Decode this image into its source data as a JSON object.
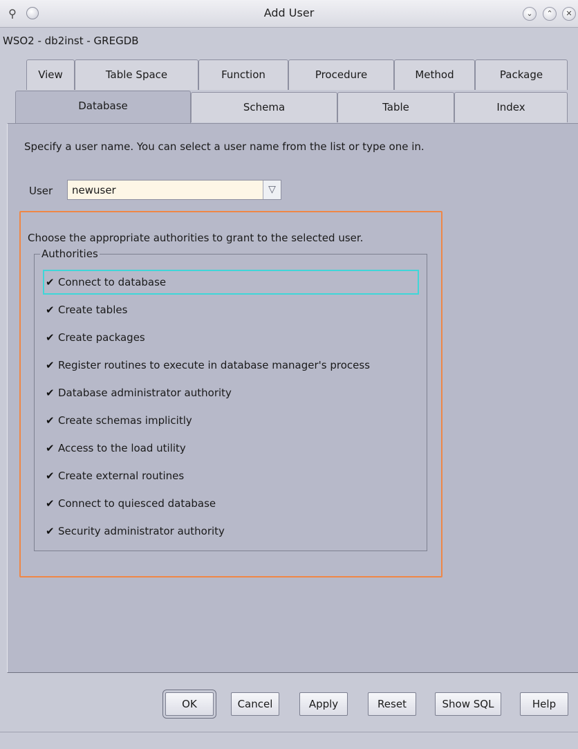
{
  "window": {
    "title": "Add User",
    "subtitle": "WSO2 - db2inst - GREGDB",
    "icon": "db-connection-icon",
    "controls": [
      "minimize",
      "maximize",
      "close"
    ]
  },
  "tabs": {
    "row1": [
      "View",
      "Table Space",
      "Function",
      "Procedure",
      "Method",
      "Package"
    ],
    "row2": [
      "Database",
      "Schema",
      "Table",
      "Index"
    ],
    "active": "Database"
  },
  "content": {
    "instruction": "Specify a user name. You can select a user name from the list or type one in.",
    "user_label": "User",
    "user_value": "newuser",
    "choose_text": "Choose the appropriate authorities to grant to the selected user.",
    "group_title": "Authorities",
    "authorities": [
      {
        "label": "Connect to database",
        "checked": true
      },
      {
        "label": "Create tables",
        "checked": true
      },
      {
        "label": "Create packages",
        "checked": true
      },
      {
        "label": "Register routines to execute in database manager's process",
        "checked": true
      },
      {
        "label": "Database administrator authority",
        "checked": true
      },
      {
        "label": "Create schemas implicitly",
        "checked": true
      },
      {
        "label": "Access to the load utility",
        "checked": true
      },
      {
        "label": "Create external routines",
        "checked": true
      },
      {
        "label": "Connect to quiesced database",
        "checked": true
      },
      {
        "label": "Security administrator authority",
        "checked": true
      }
    ],
    "check_mark": "✔"
  },
  "buttons": {
    "ok": "OK",
    "cancel": "Cancel",
    "apply": "Apply",
    "reset": "Reset",
    "show_sql": "Show SQL",
    "help": "Help"
  },
  "colors": {
    "highlight": "#ef8746",
    "focus": "#3fd6d8",
    "panel": "#b7b9c9",
    "combo_bg": "#fdf6e6"
  }
}
